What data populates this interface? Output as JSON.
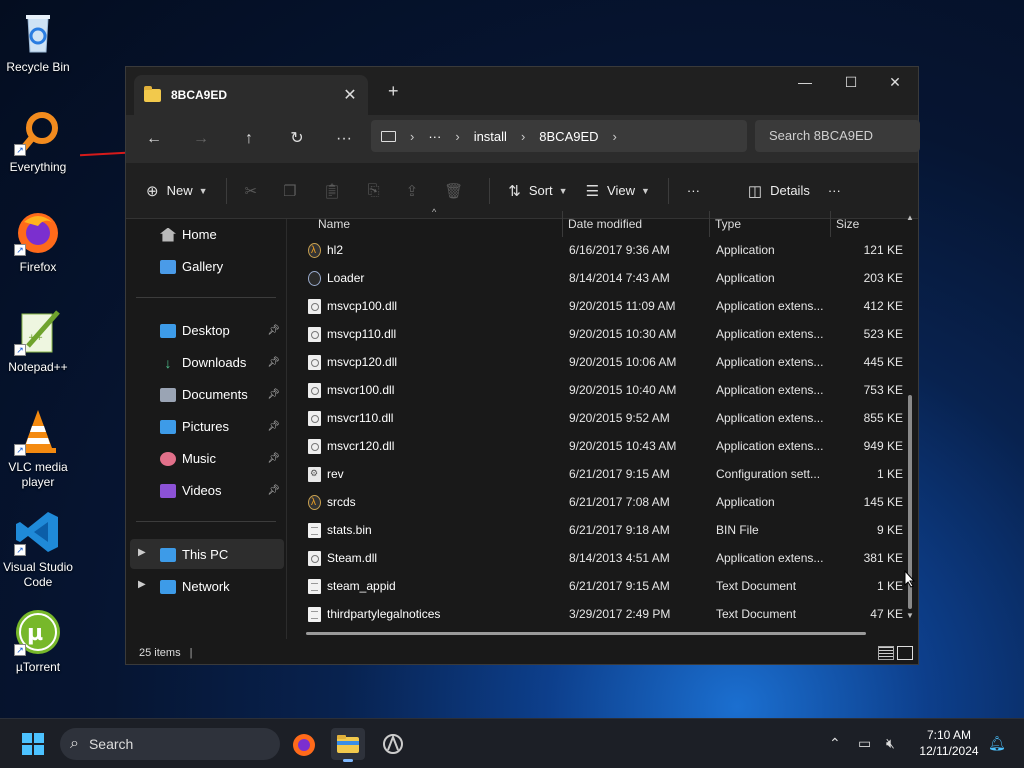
{
  "desktop": {
    "icons": [
      {
        "label": "Recycle Bin"
      },
      {
        "label": "Everything"
      },
      {
        "label": "Firefox"
      },
      {
        "label": "Notepad++"
      },
      {
        "label": "VLC media player"
      },
      {
        "label": "Visual Studio Code"
      },
      {
        "label": "µTorrent"
      }
    ]
  },
  "window": {
    "tab_title": "8BCA9ED",
    "tab_close": "✕",
    "new_tab": "+",
    "controls": {
      "minimize": "—",
      "maximize": "☐",
      "close": "✕"
    },
    "nav": {
      "back": "←",
      "forward": "→",
      "up": "↑",
      "refresh": "↻",
      "more": "···"
    },
    "breadcrumb": {
      "ellipsis": "···",
      "items": [
        "install",
        "8BCA9ED"
      ],
      "sep": "›"
    },
    "search_placeholder": "Search 8BCA9ED",
    "command_bar": {
      "new": "New",
      "sort": "Sort",
      "view": "View",
      "more": "···",
      "details": "Details",
      "more2": "···"
    },
    "sidebar": {
      "home": "Home",
      "gallery": "Gallery",
      "quick": [
        "Desktop",
        "Downloads",
        "Documents",
        "Pictures",
        "Music",
        "Videos"
      ],
      "this_pc": "This PC",
      "network": "Network"
    },
    "columns": {
      "name": "Name",
      "date": "Date modified",
      "type": "Type",
      "size": "Size"
    },
    "files": [
      {
        "name": "hl2",
        "date": "6/16/2017 9:36 AM",
        "type": "Application",
        "size": "121 KE",
        "icon": "app"
      },
      {
        "name": "Loader",
        "date": "8/14/2014 7:43 AM",
        "type": "Application",
        "size": "203 KE",
        "icon": "loader"
      },
      {
        "name": "msvcp100.dll",
        "date": "9/20/2015 11:09 AM",
        "type": "Application extens...",
        "size": "412 KE",
        "icon": "dll"
      },
      {
        "name": "msvcp110.dll",
        "date": "9/20/2015 10:30 AM",
        "type": "Application extens...",
        "size": "523 KE",
        "icon": "dll"
      },
      {
        "name": "msvcp120.dll",
        "date": "9/20/2015 10:06 AM",
        "type": "Application extens...",
        "size": "445 KE",
        "icon": "dll"
      },
      {
        "name": "msvcr100.dll",
        "date": "9/20/2015 10:40 AM",
        "type": "Application extens...",
        "size": "753 KE",
        "icon": "dll"
      },
      {
        "name": "msvcr110.dll",
        "date": "9/20/2015 9:52 AM",
        "type": "Application extens...",
        "size": "855 KE",
        "icon": "dll"
      },
      {
        "name": "msvcr120.dll",
        "date": "9/20/2015 10:43 AM",
        "type": "Application extens...",
        "size": "949 KE",
        "icon": "dll"
      },
      {
        "name": "rev",
        "date": "6/21/2017 9:15 AM",
        "type": "Configuration sett...",
        "size": "1 KE",
        "icon": "cfg"
      },
      {
        "name": "srcds",
        "date": "6/21/2017 7:08 AM",
        "type": "Application",
        "size": "145 KE",
        "icon": "app"
      },
      {
        "name": "stats.bin",
        "date": "6/21/2017 9:18 AM",
        "type": "BIN File",
        "size": "9 KE",
        "icon": "txt"
      },
      {
        "name": "Steam.dll",
        "date": "8/14/2013 4:51 AM",
        "type": "Application extens...",
        "size": "381 KE",
        "icon": "dll"
      },
      {
        "name": "steam_appid",
        "date": "6/21/2017 9:15 AM",
        "type": "Text Document",
        "size": "1 KE",
        "icon": "txt"
      },
      {
        "name": "thirdpartylegalnotices",
        "date": "3/29/2017 2:49 PM",
        "type": "Text Document",
        "size": "47 KE",
        "icon": "txt"
      }
    ],
    "status": "25 items"
  },
  "taskbar": {
    "search": "Search",
    "time": "7:10 AM",
    "date": "12/11/2024"
  },
  "colors": {
    "accent": "#0078d4",
    "folder": "#f2c94c"
  }
}
